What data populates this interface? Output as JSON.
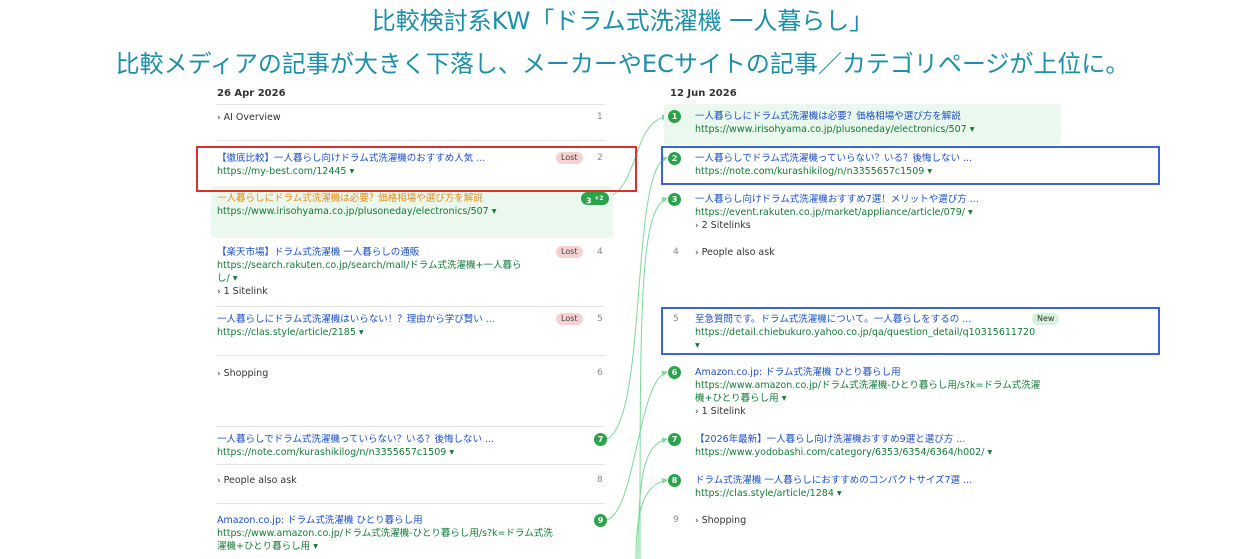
{
  "headline": {
    "line1": "比較検討系KW「ドラム式洗濯機 一人暮らし」",
    "line2": "比較メディアの記事が大きく下落し、メーカーやECサイトの記事／カテゴリページが上位に。"
  },
  "left": {
    "date": "26 Apr 2026",
    "rows": [
      {
        "rank": "1",
        "label": "AI Overview"
      },
      {
        "rank": "2",
        "title": "【徹底比較】一人暮らし向けドラム式洗濯機のおすすめ人気 ...",
        "url": "https://my-best.com/12445",
        "tag": "Lost"
      },
      {
        "badge": "3",
        "badge_sup": "+2",
        "title": "一人暮らしにドラム式洗濯機は必要？価格相場や選び方を解説",
        "url": "https://www.irisohyama.co.jp/plusoneday/electronics/507"
      },
      {
        "rank": "4",
        "title": "【楽天市場】ドラム式洗濯機 一人暮らしの通販",
        "url": "https://search.rakuten.co.jp/search/mall/ドラム式洗濯機+一人暮ら",
        "url2": "し/",
        "sub": "1 Sitelink",
        "tag": "Lost"
      },
      {
        "rank": "5",
        "title": "一人暮らしにドラム式洗濯機はいらない！？理由から学び賢い ...",
        "url": "https://clas.style/article/2185",
        "tag": "Lost"
      },
      {
        "rank": "6",
        "label": "Shopping"
      },
      {
        "badge": "7",
        "title": "一人暮らしでドラム式洗濯機っていらない？いる？後悔しない ...",
        "url": "https://note.com/kurashikilog/n/n3355657c1509"
      },
      {
        "rank": "8",
        "label": "People also ask"
      },
      {
        "badge": "9",
        "title": "Amazon.co.jp: ドラム式洗濯機 ひとり暮らし用",
        "url": "https://www.amazon.co.jp/ドラム式洗濯機-ひとり暮らし用/s?k=ドラム式洗",
        "url2": "濯機+ひとり暮らし用"
      }
    ]
  },
  "right": {
    "date": "12 Jun 2026",
    "rows": [
      {
        "badge": "1",
        "title": "一人暮らしにドラム式洗濯機は必要？価格相場や選び方を解説",
        "url": "https://www.irisohyama.co.jp/plusoneday/electronics/507"
      },
      {
        "badge": "2",
        "title": "一人暮らしでドラム式洗濯機っていらない？いる？後悔しない ...",
        "url": "https://note.com/kurashikilog/n/n3355657c1509"
      },
      {
        "badge": "3",
        "title": "一人暮らし向けドラム式洗濯機おすすめ7選！メリットや選び方 ...",
        "url": "https://event.rakuten.co.jp/market/appliance/article/079/",
        "sub": "2 Sitelinks"
      },
      {
        "rank": "4",
        "label": "People also ask"
      },
      {
        "rank": "5",
        "title": "至急質問です。ドラム式洗濯機について。一人暮らしをするの ...",
        "url": "https://detail.chiebukuro.yahoo.co.jp/qa/question_detail/q10315611720",
        "tag": "New"
      },
      {
        "badge": "6",
        "title": "Amazon.co.jp: ドラム式洗濯機 ひとり暮らし用",
        "url": "https://www.amazon.co.jp/ドラム式洗濯機-ひとり暮らし用/s?k=ドラム式洗濯",
        "url2": "機+ひとり暮らし用",
        "sub": "1 Sitelink"
      },
      {
        "badge": "7",
        "title": "【2026年最新】一人暮らし向け洗濯機おすすめ9選と選び方 ...",
        "url": "https://www.yodobashi.com/category/6353/6354/6364/h002/"
      },
      {
        "badge": "8",
        "title": "ドラム式洗濯機 一人暮らしにおすすめのコンパクトサイズ7選 ...",
        "url": "https://clas.style/article/1284"
      },
      {
        "rank": "9",
        "label": "Shopping"
      }
    ]
  },
  "colors": {
    "headline": "#1f8fa8",
    "title_link": "#1a4fc4",
    "url": "#137a36",
    "badge_green": "#2aa34a",
    "highlight_bg": "#eaf8ee",
    "red_box": "#d93030",
    "blue_box": "#3a64d8",
    "orange_title": "#f08c14"
  }
}
